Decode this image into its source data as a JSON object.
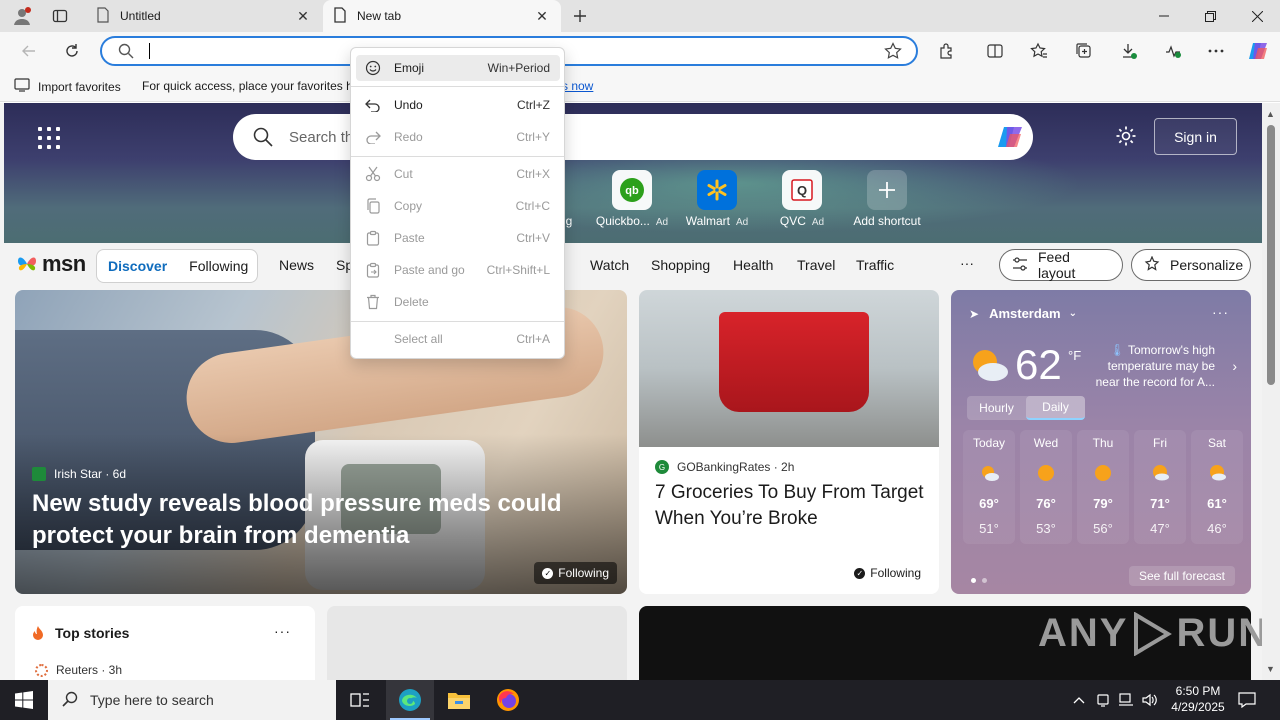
{
  "browser": {
    "tabs": [
      {
        "title": "Untitled",
        "active": false
      },
      {
        "title": "New tab",
        "active": true
      }
    ],
    "address": {
      "value": "",
      "placeholder": ""
    },
    "favorites_bar": {
      "import_label": "Import favorites",
      "hint": "For quick access, place your favorites he",
      "link": "s now"
    }
  },
  "context_menu": {
    "items": [
      {
        "label": "Emoji",
        "shortcut": "Win+Period",
        "icon": "emoji-icon",
        "disabled": false,
        "highlighted": true
      },
      {
        "label": "Undo",
        "shortcut": "Ctrl+Z",
        "icon": "undo-icon",
        "disabled": false
      },
      {
        "label": "Redo",
        "shortcut": "Ctrl+Y",
        "icon": "redo-icon",
        "disabled": true
      },
      {
        "label": "Cut",
        "shortcut": "Ctrl+X",
        "icon": "cut-icon",
        "disabled": true
      },
      {
        "label": "Copy",
        "shortcut": "Ctrl+C",
        "icon": "copy-icon",
        "disabled": true
      },
      {
        "label": "Paste",
        "shortcut": "Ctrl+V",
        "icon": "paste-icon",
        "disabled": true
      },
      {
        "label": "Paste and go",
        "shortcut": "Ctrl+Shift+L",
        "icon": "paste-go-icon",
        "disabled": true
      },
      {
        "label": "Delete",
        "shortcut": "",
        "icon": "delete-icon",
        "disabled": true
      },
      {
        "label": "Select all",
        "shortcut": "Ctrl+A",
        "icon": "",
        "disabled": true
      }
    ]
  },
  "newtab": {
    "search_placeholder": "Search th",
    "sign_in": "Sign in",
    "shortcuts": [
      {
        "label": "Quickbo...",
        "ad": "Ad",
        "color": "#2ca01c",
        "glyph": "qb"
      },
      {
        "label": "Walmart",
        "ad": "Ad",
        "color": "#0071dc",
        "glyph": "✱"
      },
      {
        "label": "QVC",
        "ad": "Ad",
        "color": "#d71920",
        "glyph": "Q"
      },
      {
        "label": "Add shortcut",
        "ad": "",
        "color": "",
        "glyph": "+"
      }
    ],
    "partial_shortcut_label": "g",
    "msn": {
      "logo": "msn",
      "feed_tabs": [
        {
          "label": "Discover",
          "active": true
        },
        {
          "label": "Following",
          "active": false
        }
      ],
      "nav": [
        "News",
        "Sp",
        "Watch",
        "Shopping",
        "Health",
        "Travel",
        "Traffic"
      ],
      "more": "···",
      "feed_layout": "Feed layout",
      "personalize": "Personalize"
    },
    "cards": {
      "main": {
        "source": "Irish Star · 6d",
        "headline": "New study reveals blood pressure meds could protect your brain from dementia",
        "following": "Following"
      },
      "grocery": {
        "source": "GOBankingRates · 2h",
        "headline": "7 Groceries To Buy From Target When You’re Broke",
        "following": "Following"
      },
      "weather": {
        "location": "Amsterdam",
        "temp": "62",
        "unit": "°F",
        "notice": "Tomorrow's high temperature may be near the record for A...",
        "modes": [
          {
            "label": "Hourly",
            "selected": false
          },
          {
            "label": "Daily",
            "selected": true
          }
        ],
        "days": [
          {
            "day": "Today",
            "hi": "69°",
            "lo": "51°",
            "icon": "partly-sunny-icon"
          },
          {
            "day": "Wed",
            "hi": "76°",
            "lo": "53°",
            "icon": "sun-icon"
          },
          {
            "day": "Thu",
            "hi": "79°",
            "lo": "56°",
            "icon": "sun-icon"
          },
          {
            "day": "Fri",
            "hi": "71°",
            "lo": "47°",
            "icon": "partly-sunny-icon"
          },
          {
            "day": "Sat",
            "hi": "61°",
            "lo": "46°",
            "icon": "partly-sunny-icon"
          }
        ],
        "see_forecast": "See full forecast"
      },
      "top_stories": {
        "title": "Top stories",
        "source": "Reuters · 3h"
      }
    },
    "watermark": {
      "left": "ANY",
      "right": "RUN"
    }
  },
  "taskbar": {
    "search_placeholder": "Type here to search",
    "time": "6:50 PM",
    "date": "4/29/2025"
  },
  "colors": {
    "accent": "#2a7ddc",
    "msn_active": "#0f6cbd",
    "taskbar": "#1f1f25"
  }
}
